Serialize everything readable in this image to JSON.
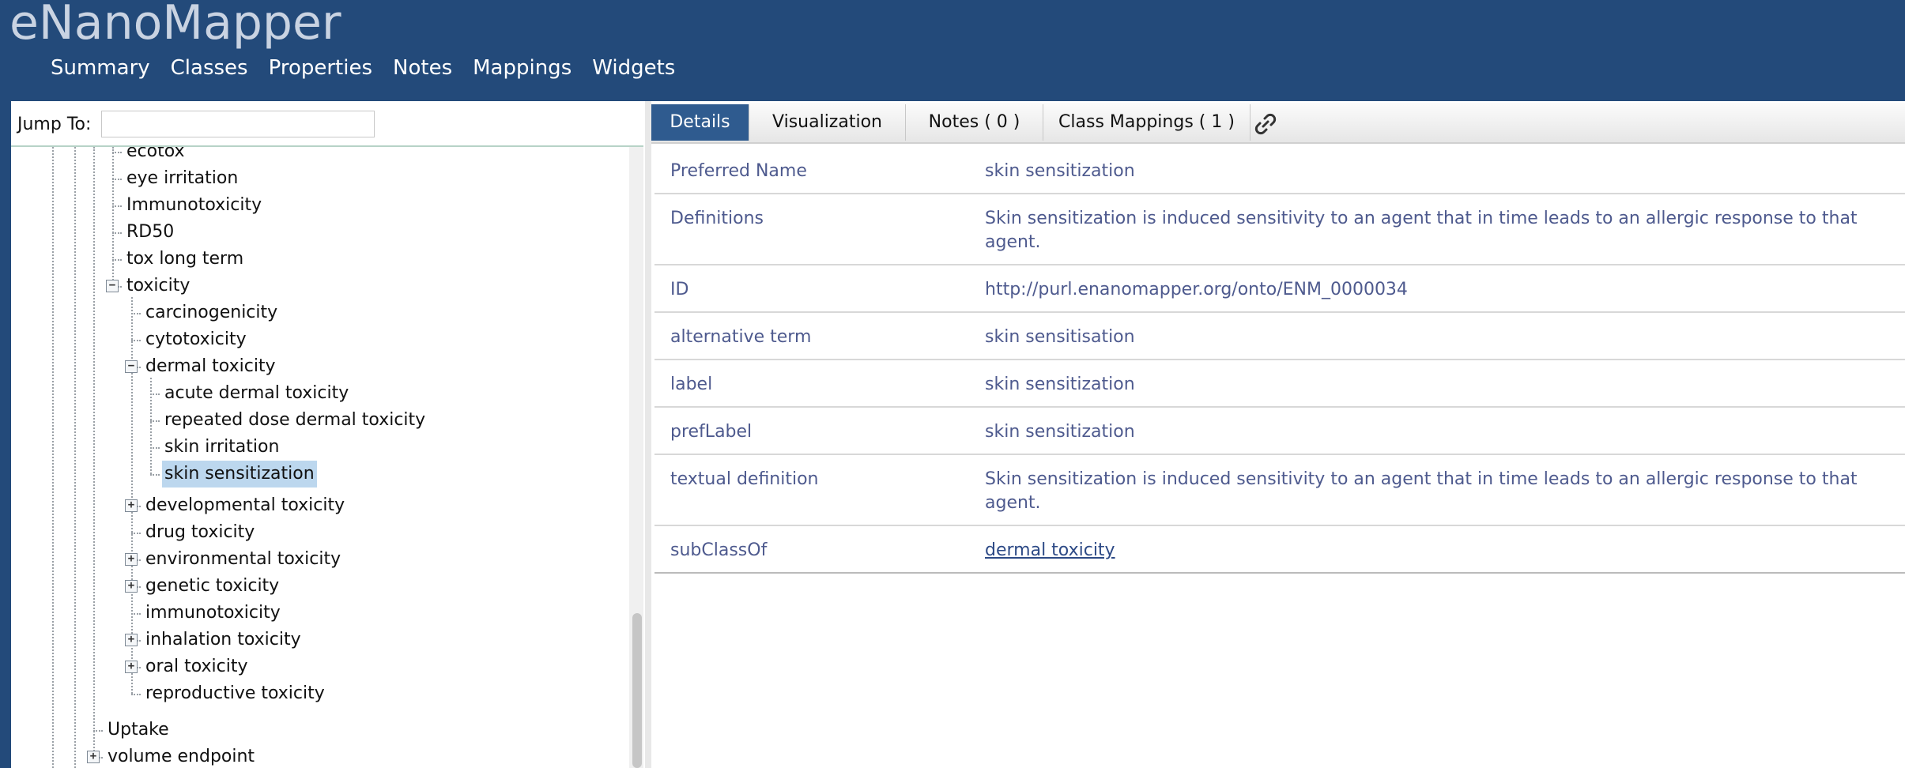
{
  "app": {
    "title": "eNanoMapper"
  },
  "nav": [
    "Summary",
    "Classes",
    "Properties",
    "Notes",
    "Mappings",
    "Widgets"
  ],
  "left_panel": {
    "jump_label": "Jump To:",
    "jump_value": "",
    "tree": [
      {
        "label": "ecotox",
        "level": 1,
        "toggle": "none"
      },
      {
        "label": "eye irritation",
        "level": 1,
        "toggle": "none"
      },
      {
        "label": "Immunotoxicity",
        "level": 1,
        "toggle": "none"
      },
      {
        "label": "RD50",
        "level": 1,
        "toggle": "none"
      },
      {
        "label": "tox long term",
        "level": 1,
        "toggle": "none"
      },
      {
        "label": "toxicity",
        "level": 1,
        "toggle": "minus"
      },
      {
        "label": "carcinogenicity",
        "level": 2,
        "toggle": "none"
      },
      {
        "label": "cytotoxicity",
        "level": 2,
        "toggle": "none"
      },
      {
        "label": "dermal toxicity",
        "level": 2,
        "toggle": "minus"
      },
      {
        "label": "acute dermal toxicity",
        "level": 3,
        "toggle": "none"
      },
      {
        "label": "repeated dose dermal toxicity",
        "level": 3,
        "toggle": "none"
      },
      {
        "label": "skin irritation",
        "level": 3,
        "toggle": "none"
      },
      {
        "label": "skin sensitization",
        "level": 3,
        "toggle": "none",
        "selected": true
      },
      {
        "label": "developmental toxicity",
        "level": 2,
        "toggle": "plus"
      },
      {
        "label": "drug toxicity",
        "level": 2,
        "toggle": "none"
      },
      {
        "label": "environmental toxicity",
        "level": 2,
        "toggle": "plus"
      },
      {
        "label": "genetic toxicity",
        "level": 2,
        "toggle": "plus"
      },
      {
        "label": "immunotoxicity",
        "level": 2,
        "toggle": "none"
      },
      {
        "label": "inhalation toxicity",
        "level": 2,
        "toggle": "plus"
      },
      {
        "label": "oral toxicity",
        "level": 2,
        "toggle": "plus"
      },
      {
        "label": "reproductive toxicity",
        "level": 2,
        "toggle": "none"
      },
      {
        "label": "Uptake",
        "level": 0,
        "toggle": "none"
      },
      {
        "label": "volume endpoint",
        "level": 0,
        "toggle": "plus"
      }
    ]
  },
  "tabs": [
    {
      "label": "Details",
      "active": true
    },
    {
      "label": "Visualization",
      "active": false
    },
    {
      "label": "Notes ( 0 )",
      "active": false
    },
    {
      "label": "Class Mappings ( 1 )",
      "active": false
    }
  ],
  "details": [
    {
      "key": "Preferred Name",
      "value": "skin sensitization"
    },
    {
      "key": "Definitions",
      "value": "Skin sensitization is induced sensitivity to an agent that in time leads to an allergic response to that agent."
    },
    {
      "key": "ID",
      "value": "http://purl.enanomapper.org/onto/ENM_0000034"
    },
    {
      "key": "alternative term",
      "value": "skin sensitisation"
    },
    {
      "key": "label",
      "value": "skin sensitization"
    },
    {
      "key": "prefLabel",
      "value": "skin sensitization"
    },
    {
      "key": "textual definition",
      "value": "Skin sensitization is induced sensitivity to an agent that in time leads to an allergic response to that agent."
    },
    {
      "key": "subClassOf",
      "value": "dermal toxicity",
      "link": true
    }
  ],
  "colors": {
    "header_bg": "#234a7a",
    "active_tab": "#2f5b8f",
    "selected_node": "#bcd7ee",
    "detail_text": "#4e5a8e"
  }
}
